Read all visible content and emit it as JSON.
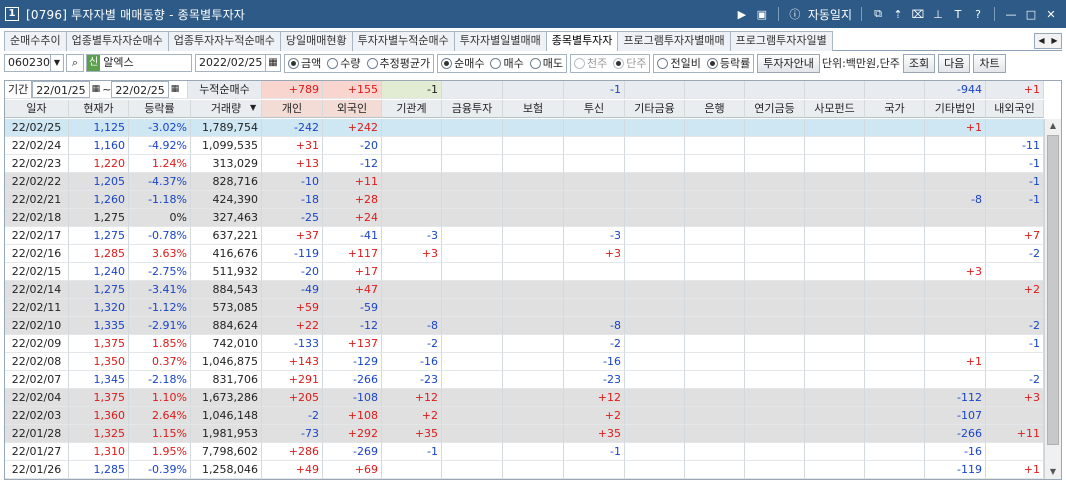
{
  "window": {
    "badge": "1",
    "title": "[0796] 투자자별 매매동향 - 종목별투자자",
    "autolog": "자동일지"
  },
  "tabs": [
    "순매수추이",
    "업종별투자자순매수",
    "업종투자자누적순매수",
    "당일매매현황",
    "투자자별누적순매수",
    "투자자별일별매매",
    "종목별투자자",
    "프로그램투자자별매매",
    "프로그램투자자일별"
  ],
  "active_tab": 6,
  "controls": {
    "code": "060230",
    "new_badge": "신",
    "stock_name": "알엑스",
    "date": "2022/02/25",
    "value_type": [
      "금액",
      "수량",
      "추정평균가"
    ],
    "trade_type": [
      "순매수",
      "매수",
      "매도"
    ],
    "unit_share": [
      "천주",
      "단주"
    ],
    "compare": [
      "전일비",
      "등락률"
    ],
    "guide_button": "투자자안내",
    "unit_label": "단위:백만원,단주",
    "search_button": "조회",
    "next_button": "다음",
    "chart_button": "차트"
  },
  "period": {
    "label": "기간",
    "from": "22/01/25",
    "to": "22/02/25",
    "cumulative_label": "누적순매수"
  },
  "summary": {
    "individual": "+789",
    "foreign": "+155",
    "institution": "-1",
    "trust": "-1",
    "other_corp": "-944",
    "domestic_foreign": "+1"
  },
  "columns": [
    "일자",
    "현재가",
    "등락률",
    "거래량",
    "개인",
    "외국인",
    "기관계",
    "금융투자",
    "보험",
    "투신",
    "기타금융",
    "은행",
    "연기금등",
    "사모펀드",
    "국가",
    "기타법인",
    "내외국인"
  ],
  "rows": [
    {
      "date": "22/02/25",
      "price": "1,125",
      "rate": "-3.02%",
      "vol": "1,789,754",
      "ind": "-242",
      "frn": "+242",
      "inst": "",
      "fin": "",
      "ins": "",
      "trust": "",
      "ofin": "",
      "bank": "",
      "pension": "",
      "pe": "",
      "gov": "",
      "ocorp": "+1",
      "dfrn": ""
    },
    {
      "date": "22/02/24",
      "price": "1,160",
      "rate": "-4.92%",
      "vol": "1,099,535",
      "ind": "+31",
      "frn": "-20",
      "inst": "",
      "fin": "",
      "ins": "",
      "trust": "",
      "ofin": "",
      "bank": "",
      "pension": "",
      "pe": "",
      "gov": "",
      "ocorp": "",
      "dfrn": "-11"
    },
    {
      "date": "22/02/23",
      "price": "1,220",
      "rate": "1.24%",
      "vol": "313,029",
      "ind": "+13",
      "frn": "-12",
      "inst": "",
      "fin": "",
      "ins": "",
      "trust": "",
      "ofin": "",
      "bank": "",
      "pension": "",
      "pe": "",
      "gov": "",
      "ocorp": "",
      "dfrn": "-1"
    },
    {
      "date": "22/02/22",
      "price": "1,205",
      "rate": "-4.37%",
      "vol": "828,716",
      "ind": "-10",
      "frn": "+11",
      "inst": "",
      "fin": "",
      "ins": "",
      "trust": "",
      "ofin": "",
      "bank": "",
      "pension": "",
      "pe": "",
      "gov": "",
      "ocorp": "",
      "dfrn": "-1"
    },
    {
      "date": "22/02/21",
      "price": "1,260",
      "rate": "-1.18%",
      "vol": "424,390",
      "ind": "-18",
      "frn": "+28",
      "inst": "",
      "fin": "",
      "ins": "",
      "trust": "",
      "ofin": "",
      "bank": "",
      "pension": "",
      "pe": "",
      "gov": "",
      "ocorp": "-8",
      "dfrn": "-1"
    },
    {
      "date": "22/02/18",
      "price": "1,275",
      "rate": "0%",
      "vol": "327,463",
      "ind": "-25",
      "frn": "+24",
      "inst": "",
      "fin": "",
      "ins": "",
      "trust": "",
      "ofin": "",
      "bank": "",
      "pension": "",
      "pe": "",
      "gov": "",
      "ocorp": "",
      "dfrn": ""
    },
    {
      "date": "22/02/17",
      "price": "1,275",
      "rate": "-0.78%",
      "vol": "637,221",
      "ind": "+37",
      "frn": "-41",
      "inst": "-3",
      "fin": "",
      "ins": "",
      "trust": "-3",
      "ofin": "",
      "bank": "",
      "pension": "",
      "pe": "",
      "gov": "",
      "ocorp": "",
      "dfrn": "+7"
    },
    {
      "date": "22/02/16",
      "price": "1,285",
      "rate": "3.63%",
      "vol": "416,676",
      "ind": "-119",
      "frn": "+117",
      "inst": "+3",
      "fin": "",
      "ins": "",
      "trust": "+3",
      "ofin": "",
      "bank": "",
      "pension": "",
      "pe": "",
      "gov": "",
      "ocorp": "",
      "dfrn": "-2"
    },
    {
      "date": "22/02/15",
      "price": "1,240",
      "rate": "-2.75%",
      "vol": "511,932",
      "ind": "-20",
      "frn": "+17",
      "inst": "",
      "fin": "",
      "ins": "",
      "trust": "",
      "ofin": "",
      "bank": "",
      "pension": "",
      "pe": "",
      "gov": "",
      "ocorp": "+3",
      "dfrn": ""
    },
    {
      "date": "22/02/14",
      "price": "1,275",
      "rate": "-3.41%",
      "vol": "884,543",
      "ind": "-49",
      "frn": "+47",
      "inst": "",
      "fin": "",
      "ins": "",
      "trust": "",
      "ofin": "",
      "bank": "",
      "pension": "",
      "pe": "",
      "gov": "",
      "ocorp": "",
      "dfrn": "+2"
    },
    {
      "date": "22/02/11",
      "price": "1,320",
      "rate": "-1.12%",
      "vol": "573,085",
      "ind": "+59",
      "frn": "-59",
      "inst": "",
      "fin": "",
      "ins": "",
      "trust": "",
      "ofin": "",
      "bank": "",
      "pension": "",
      "pe": "",
      "gov": "",
      "ocorp": "",
      "dfrn": ""
    },
    {
      "date": "22/02/10",
      "price": "1,335",
      "rate": "-2.91%",
      "vol": "884,624",
      "ind": "+22",
      "frn": "-12",
      "inst": "-8",
      "fin": "",
      "ins": "",
      "trust": "-8",
      "ofin": "",
      "bank": "",
      "pension": "",
      "pe": "",
      "gov": "",
      "ocorp": "",
      "dfrn": "-2"
    },
    {
      "date": "22/02/09",
      "price": "1,375",
      "rate": "1.85%",
      "vol": "742,010",
      "ind": "-133",
      "frn": "+137",
      "inst": "-2",
      "fin": "",
      "ins": "",
      "trust": "-2",
      "ofin": "",
      "bank": "",
      "pension": "",
      "pe": "",
      "gov": "",
      "ocorp": "",
      "dfrn": "-1"
    },
    {
      "date": "22/02/08",
      "price": "1,350",
      "rate": "0.37%",
      "vol": "1,046,875",
      "ind": "+143",
      "frn": "-129",
      "inst": "-16",
      "fin": "",
      "ins": "",
      "trust": "-16",
      "ofin": "",
      "bank": "",
      "pension": "",
      "pe": "",
      "gov": "",
      "ocorp": "+1",
      "dfrn": ""
    },
    {
      "date": "22/02/07",
      "price": "1,345",
      "rate": "-2.18%",
      "vol": "831,706",
      "ind": "+291",
      "frn": "-266",
      "inst": "-23",
      "fin": "",
      "ins": "",
      "trust": "-23",
      "ofin": "",
      "bank": "",
      "pension": "",
      "pe": "",
      "gov": "",
      "ocorp": "",
      "dfrn": "-2"
    },
    {
      "date": "22/02/04",
      "price": "1,375",
      "rate": "1.10%",
      "vol": "1,673,286",
      "ind": "+205",
      "frn": "-108",
      "inst": "+12",
      "fin": "",
      "ins": "",
      "trust": "+12",
      "ofin": "",
      "bank": "",
      "pension": "",
      "pe": "",
      "gov": "",
      "ocorp": "-112",
      "dfrn": "+3"
    },
    {
      "date": "22/02/03",
      "price": "1,360",
      "rate": "2.64%",
      "vol": "1,046,148",
      "ind": "-2",
      "frn": "+108",
      "inst": "+2",
      "fin": "",
      "ins": "",
      "trust": "+2",
      "ofin": "",
      "bank": "",
      "pension": "",
      "pe": "",
      "gov": "",
      "ocorp": "-107",
      "dfrn": ""
    },
    {
      "date": "22/01/28",
      "price": "1,325",
      "rate": "1.15%",
      "vol": "1,981,953",
      "ind": "-73",
      "frn": "+292",
      "inst": "+35",
      "fin": "",
      "ins": "",
      "trust": "+35",
      "ofin": "",
      "bank": "",
      "pension": "",
      "pe": "",
      "gov": "",
      "ocorp": "-266",
      "dfrn": "+11"
    },
    {
      "date": "22/01/27",
      "price": "1,310",
      "rate": "1.95%",
      "vol": "7,798,602",
      "ind": "+286",
      "frn": "-269",
      "inst": "-1",
      "fin": "",
      "ins": "",
      "trust": "-1",
      "ofin": "",
      "bank": "",
      "pension": "",
      "pe": "",
      "gov": "",
      "ocorp": "-16",
      "dfrn": ""
    },
    {
      "date": "22/01/26",
      "price": "1,285",
      "rate": "-0.39%",
      "vol": "1,258,046",
      "ind": "+49",
      "frn": "+69",
      "inst": "",
      "fin": "",
      "ins": "",
      "trust": "",
      "ofin": "",
      "bank": "",
      "pension": "",
      "pe": "",
      "gov": "",
      "ocorp": "-119",
      "dfrn": "+1"
    }
  ],
  "colors": {
    "up": "#e01818",
    "down": "#1844c8",
    "selected": "#cfe6f3",
    "shade": "#e0e0e0"
  }
}
